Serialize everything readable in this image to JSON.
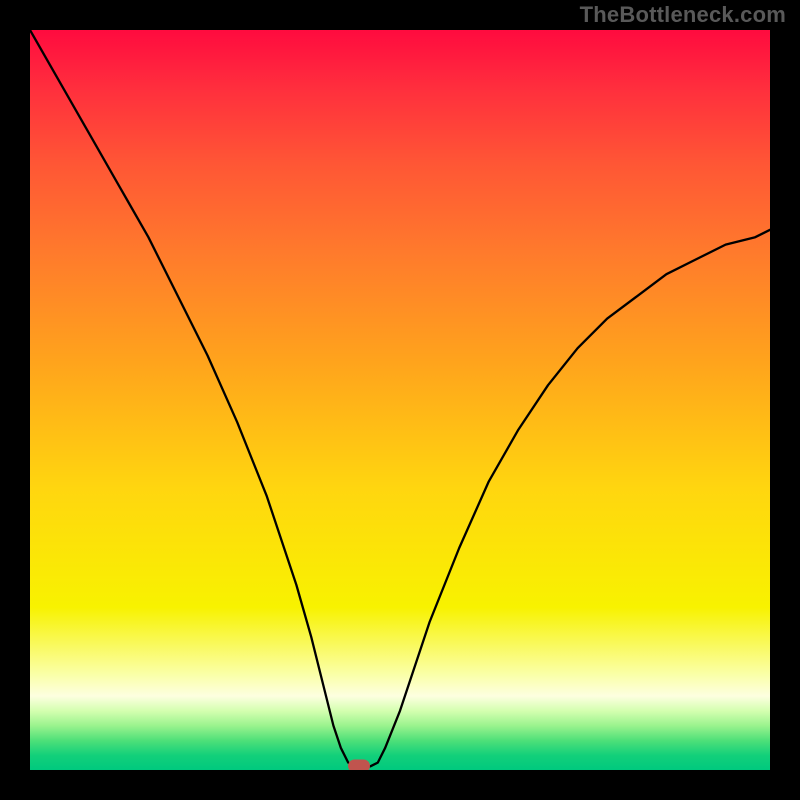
{
  "watermark": "TheBottleneck.com",
  "chart_data": {
    "type": "line",
    "title": "",
    "xlabel": "",
    "ylabel": "",
    "xlim": [
      0,
      100
    ],
    "ylim": [
      0,
      100
    ],
    "grid": false,
    "legend": false,
    "background": "red-to-green vertical gradient",
    "series": [
      {
        "name": "bottleneck-curve",
        "color": "#000000",
        "x": [
          0,
          4,
          8,
          12,
          16,
          20,
          24,
          28,
          32,
          36,
          38,
          40,
          41,
          42,
          43,
          44,
          45,
          46,
          47,
          48,
          50,
          54,
          58,
          62,
          66,
          70,
          74,
          78,
          82,
          86,
          90,
          94,
          98,
          100
        ],
        "y": [
          100,
          93,
          86,
          79,
          72,
          64,
          56,
          47,
          37,
          25,
          18,
          10,
          6,
          3,
          1,
          0.5,
          0.5,
          0.5,
          1,
          3,
          8,
          20,
          30,
          39,
          46,
          52,
          57,
          61,
          64,
          67,
          69,
          71,
          72,
          73
        ]
      }
    ],
    "marker": {
      "x": 44.5,
      "y": 0.5,
      "color": "#c0544e"
    },
    "gradient_stops": [
      {
        "pos": 0,
        "color": "#ff0b3f"
      },
      {
        "pos": 18,
        "color": "#ff5635"
      },
      {
        "pos": 45,
        "color": "#ffa41c"
      },
      {
        "pos": 78,
        "color": "#f8f200"
      },
      {
        "pos": 90,
        "color": "#fdffe0"
      },
      {
        "pos": 100,
        "color": "#00c97e"
      }
    ]
  }
}
